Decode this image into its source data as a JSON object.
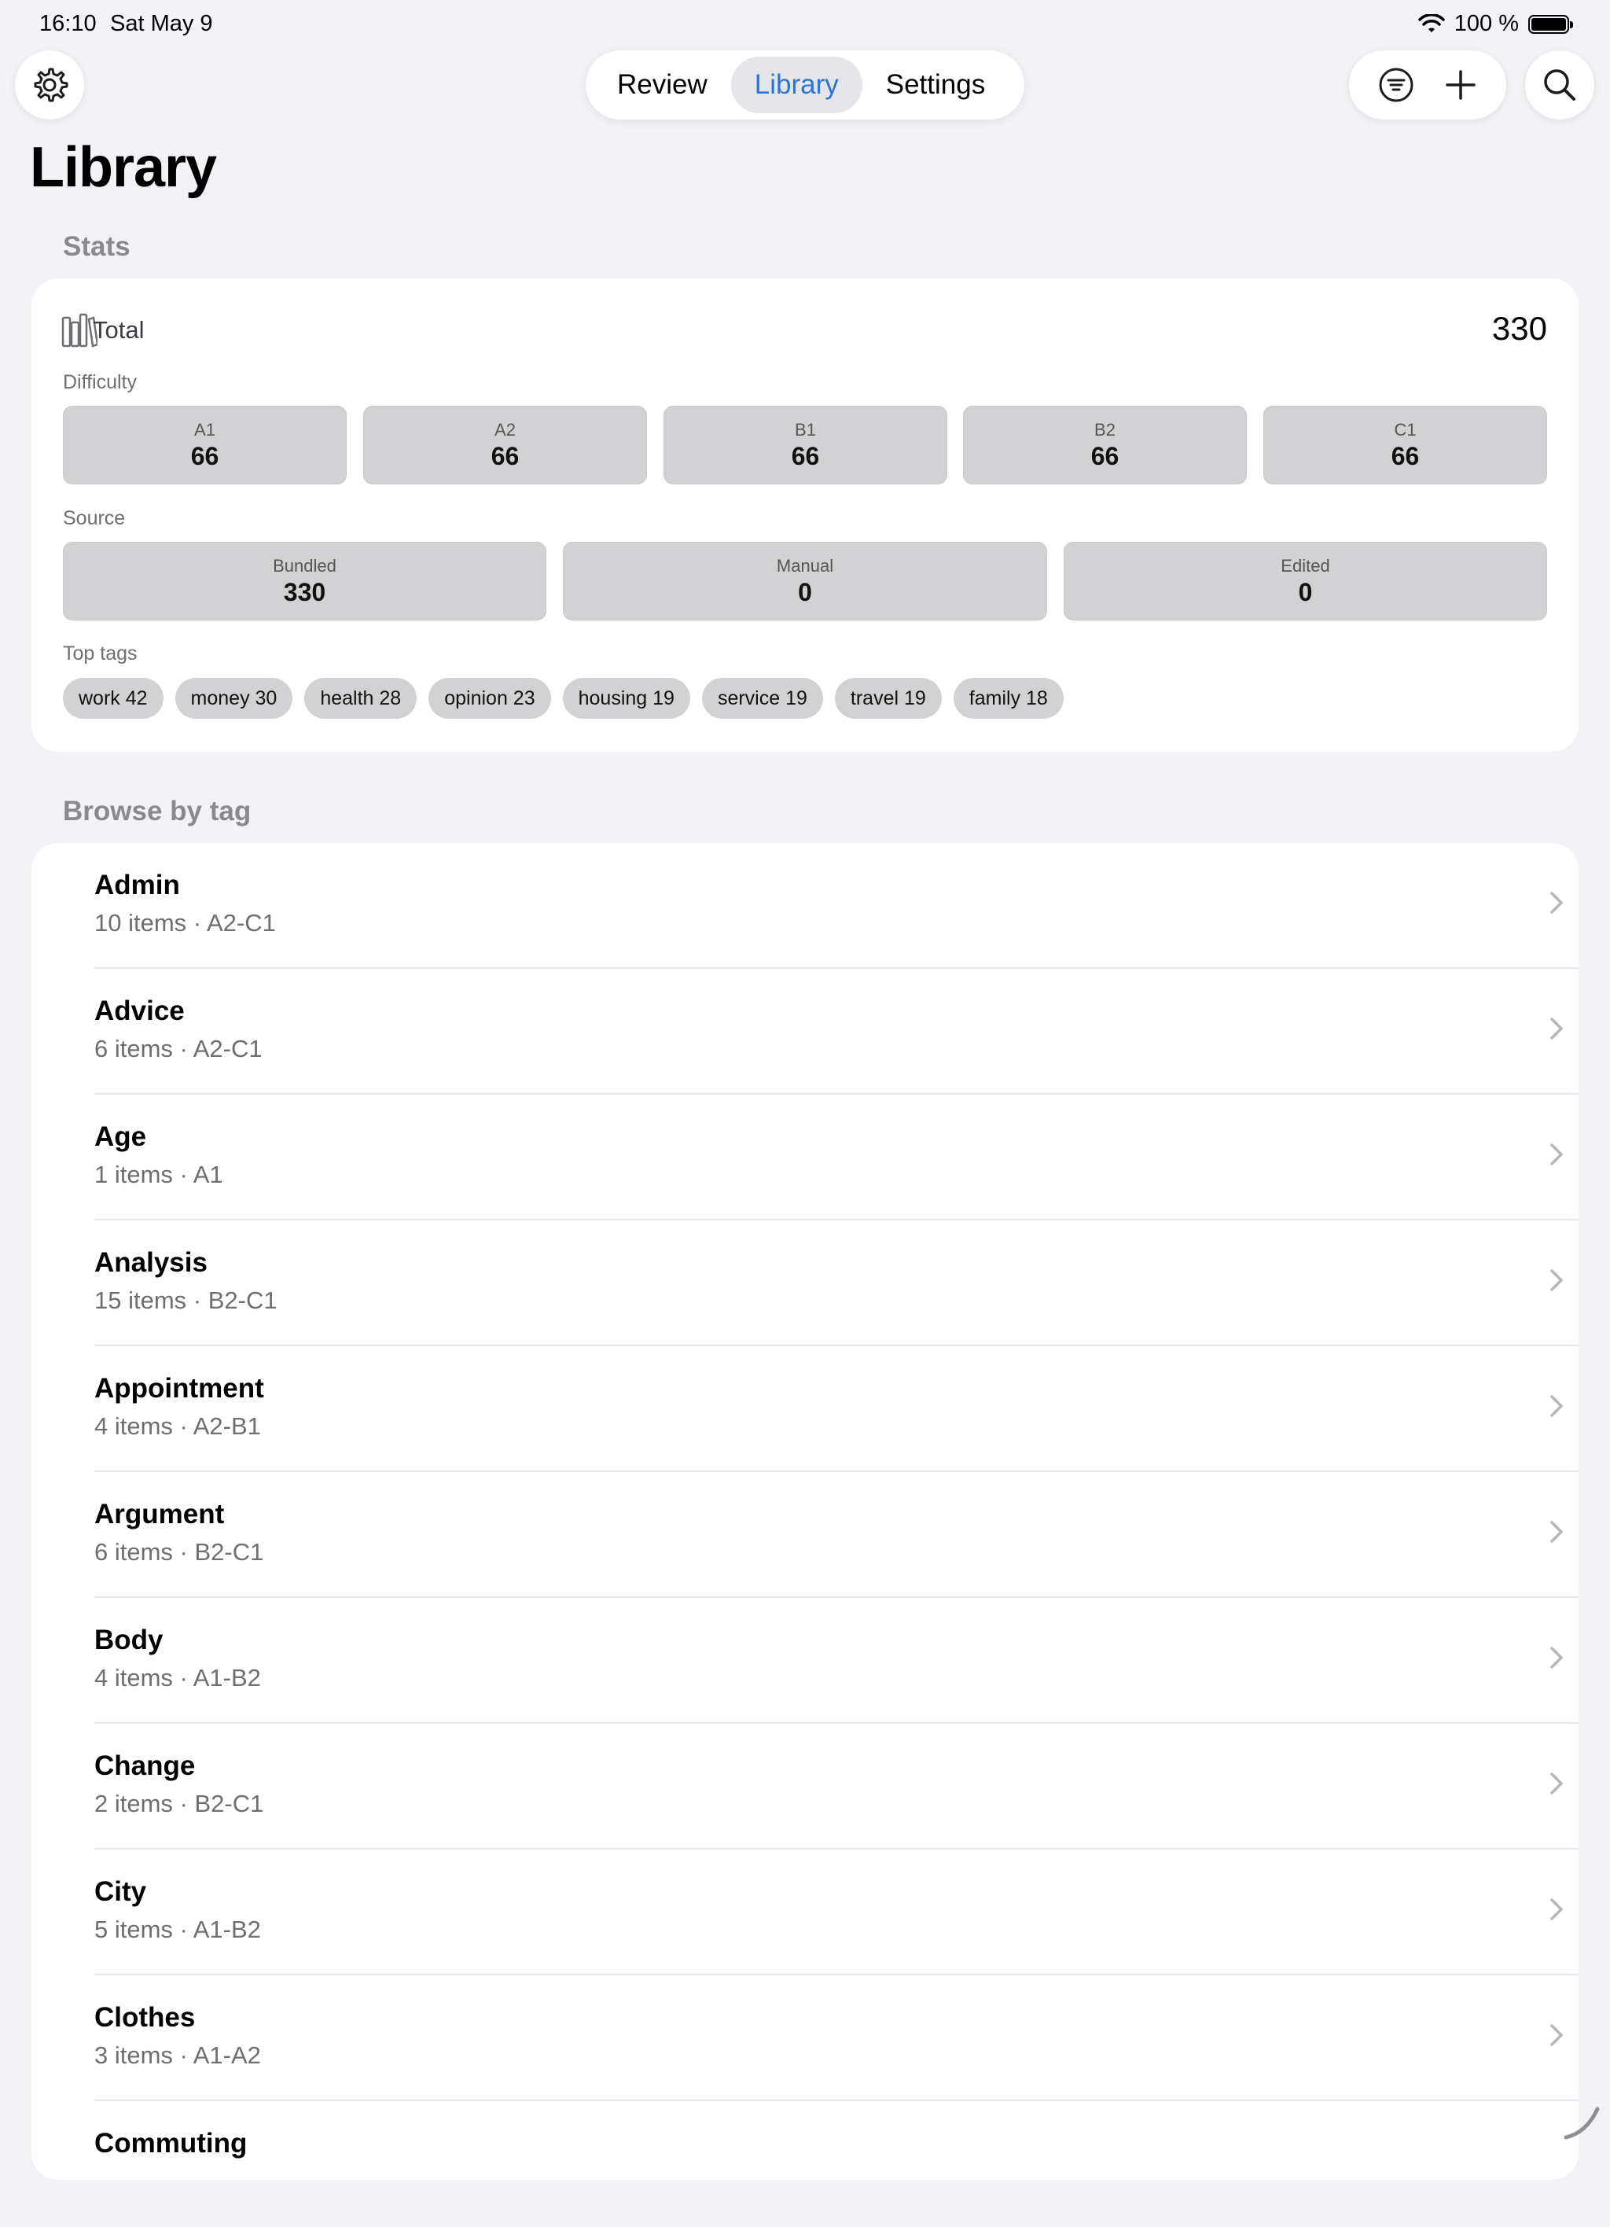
{
  "status": {
    "time": "16:10",
    "date": "Sat May 9",
    "battery": "100 %"
  },
  "nav": {
    "tabs": [
      {
        "label": "Review"
      },
      {
        "label": "Library"
      },
      {
        "label": "Settings"
      }
    ],
    "active_tab": "Library"
  },
  "page": {
    "title": "Library"
  },
  "stats": {
    "header": "Stats",
    "total_label": "Total",
    "total_value": "330",
    "difficulty_label": "Difficulty",
    "difficulty": [
      {
        "label": "A1",
        "value": "66"
      },
      {
        "label": "A2",
        "value": "66"
      },
      {
        "label": "B1",
        "value": "66"
      },
      {
        "label": "B2",
        "value": "66"
      },
      {
        "label": "C1",
        "value": "66"
      }
    ],
    "source_label": "Source",
    "source": [
      {
        "label": "Bundled",
        "value": "330"
      },
      {
        "label": "Manual",
        "value": "0"
      },
      {
        "label": "Edited",
        "value": "0"
      }
    ],
    "top_tags_label": "Top tags",
    "top_tags": [
      "work 42",
      "money 30",
      "health 28",
      "opinion 23",
      "housing 19",
      "service 19",
      "travel 19",
      "family 18"
    ]
  },
  "browse": {
    "header": "Browse by tag",
    "items": [
      {
        "title": "Admin",
        "subtitle": "10 items · A2-C1"
      },
      {
        "title": "Advice",
        "subtitle": "6 items · A2-C1"
      },
      {
        "title": "Age",
        "subtitle": "1 items · A1"
      },
      {
        "title": "Analysis",
        "subtitle": "15 items · B2-C1"
      },
      {
        "title": "Appointment",
        "subtitle": "4 items · A2-B1"
      },
      {
        "title": "Argument",
        "subtitle": "6 items · B2-C1"
      },
      {
        "title": "Body",
        "subtitle": "4 items · A1-B2"
      },
      {
        "title": "Change",
        "subtitle": "2 items · B2-C1"
      },
      {
        "title": "City",
        "subtitle": "5 items · A1-B2"
      },
      {
        "title": "Clothes",
        "subtitle": "3 items · A1-A2"
      },
      {
        "title": "Commuting",
        "subtitle": ""
      }
    ]
  },
  "colors": {
    "accent": "#2b74d8",
    "background": "#f2f2f7",
    "tile": "#d2d2d4"
  },
  "icons": [
    "gear-icon",
    "filter-icon",
    "plus-icon",
    "search-icon",
    "books-icon",
    "chevron-right-icon",
    "wifi-icon",
    "battery-icon"
  ]
}
